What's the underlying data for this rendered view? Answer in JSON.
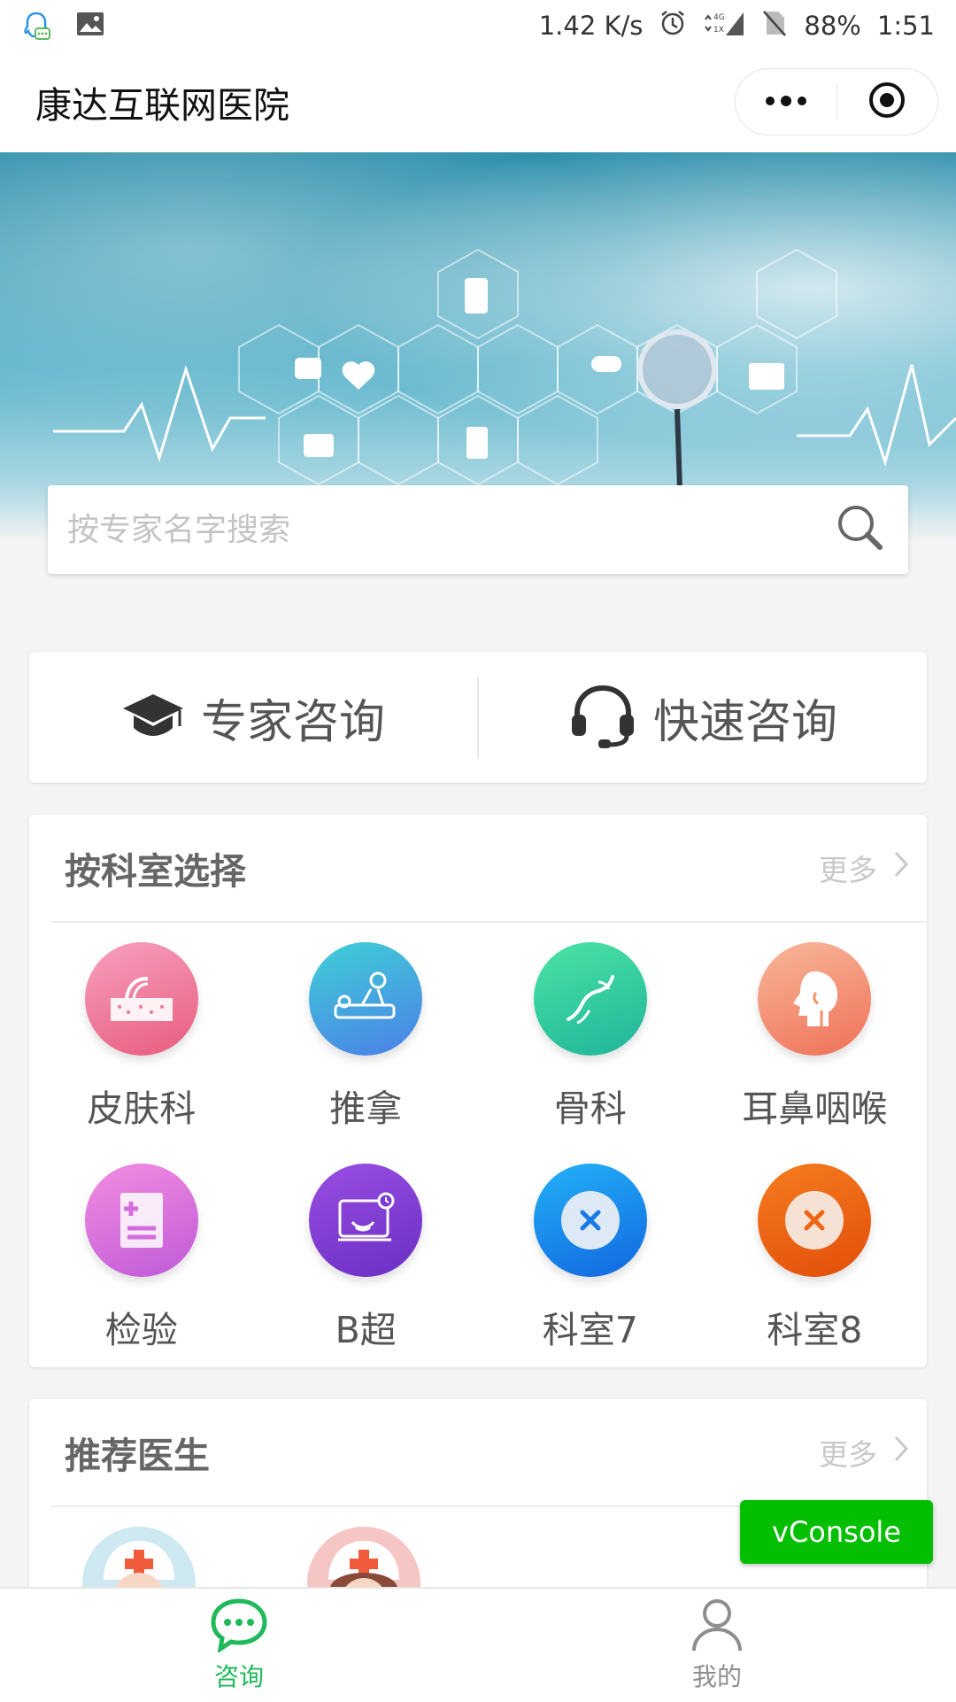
{
  "status_bar": {
    "speed": "1.42 K/s",
    "network": "4G",
    "network_sub": "1X",
    "battery": "88%",
    "time": "1:51"
  },
  "header": {
    "title": "康达互联网医院"
  },
  "search": {
    "placeholder": "按专家名字搜索"
  },
  "consult": {
    "expert_label": "专家咨询",
    "quick_label": "快速咨询"
  },
  "departments": {
    "title": "按科室选择",
    "more": "更多",
    "items": [
      {
        "label": "皮肤科",
        "icon": "skin-icon",
        "color": "#ef6b8b"
      },
      {
        "label": "推拿",
        "icon": "massage-icon",
        "color": "#3fb8e8"
      },
      {
        "label": "骨科",
        "icon": "bone-icon",
        "color": "#33c995"
      },
      {
        "label": "耳鼻咽喉",
        "icon": "ent-icon",
        "color": "#f3906a"
      },
      {
        "label": "检验",
        "icon": "lab-icon",
        "color": "#d46ddc"
      },
      {
        "label": "B超",
        "icon": "ultrasound-icon",
        "color": "#7c3bd4"
      },
      {
        "label": "科室7",
        "icon": "close-x-icon",
        "color": "#1a8ef0"
      },
      {
        "label": "科室8",
        "icon": "close-x-icon",
        "color": "#ee6514"
      }
    ]
  },
  "doctors": {
    "title": "推荐医生",
    "more": "更多"
  },
  "vconsole": {
    "label": "vConsole"
  },
  "tabbar": {
    "items": [
      {
        "label": "咨询",
        "icon": "chat-icon",
        "active": true
      },
      {
        "label": "我的",
        "icon": "user-icon",
        "active": false
      }
    ],
    "active_color": "#1fb95a",
    "inactive_color": "#8e8e8e"
  }
}
